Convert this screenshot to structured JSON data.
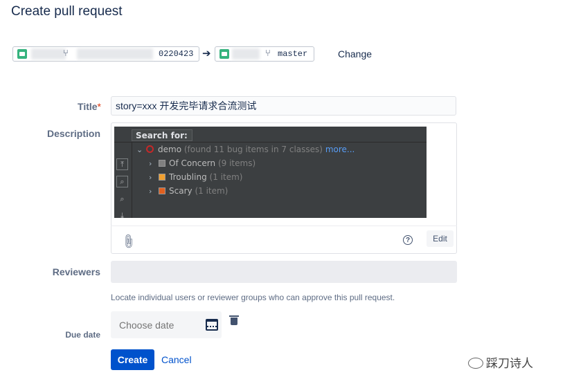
{
  "page": {
    "title": "Create pull request"
  },
  "source": {
    "branch_suffix": "0220423"
  },
  "target": {
    "branch": "master"
  },
  "change_link": "Change",
  "form": {
    "title_label": "Title",
    "required_mark": "*",
    "title_value": "story=xxx 开发完毕请求合流测试",
    "description_label": "Description",
    "reviewers_label": "Reviewers",
    "reviewers_helper": "Locate individual users or reviewer groups who can approve this pull request.",
    "due_date_label": "Due date",
    "due_date_placeholder": "Choose date",
    "edit_button": "Edit",
    "help_symbol": "?",
    "create_button": "Create",
    "cancel_link": "Cancel"
  },
  "embedded_screenshot": {
    "search_label": "Search for:",
    "root": {
      "name": "demo",
      "summary": "(found 11 bug items in 7 classes)",
      "more": "more..."
    },
    "items": [
      {
        "label": "Of Concern",
        "count": "(9 items)",
        "color": "#808080"
      },
      {
        "label": "Troubling",
        "count": "(1 item)",
        "color": "#f0a030"
      },
      {
        "label": "Scary",
        "count": "(1 item)",
        "color": "#e06020"
      }
    ]
  },
  "watermark": "踩刀诗人",
  "colors": {
    "primary": "#0052cc",
    "repo_icon": "#36b37e",
    "required": "#de350b"
  }
}
